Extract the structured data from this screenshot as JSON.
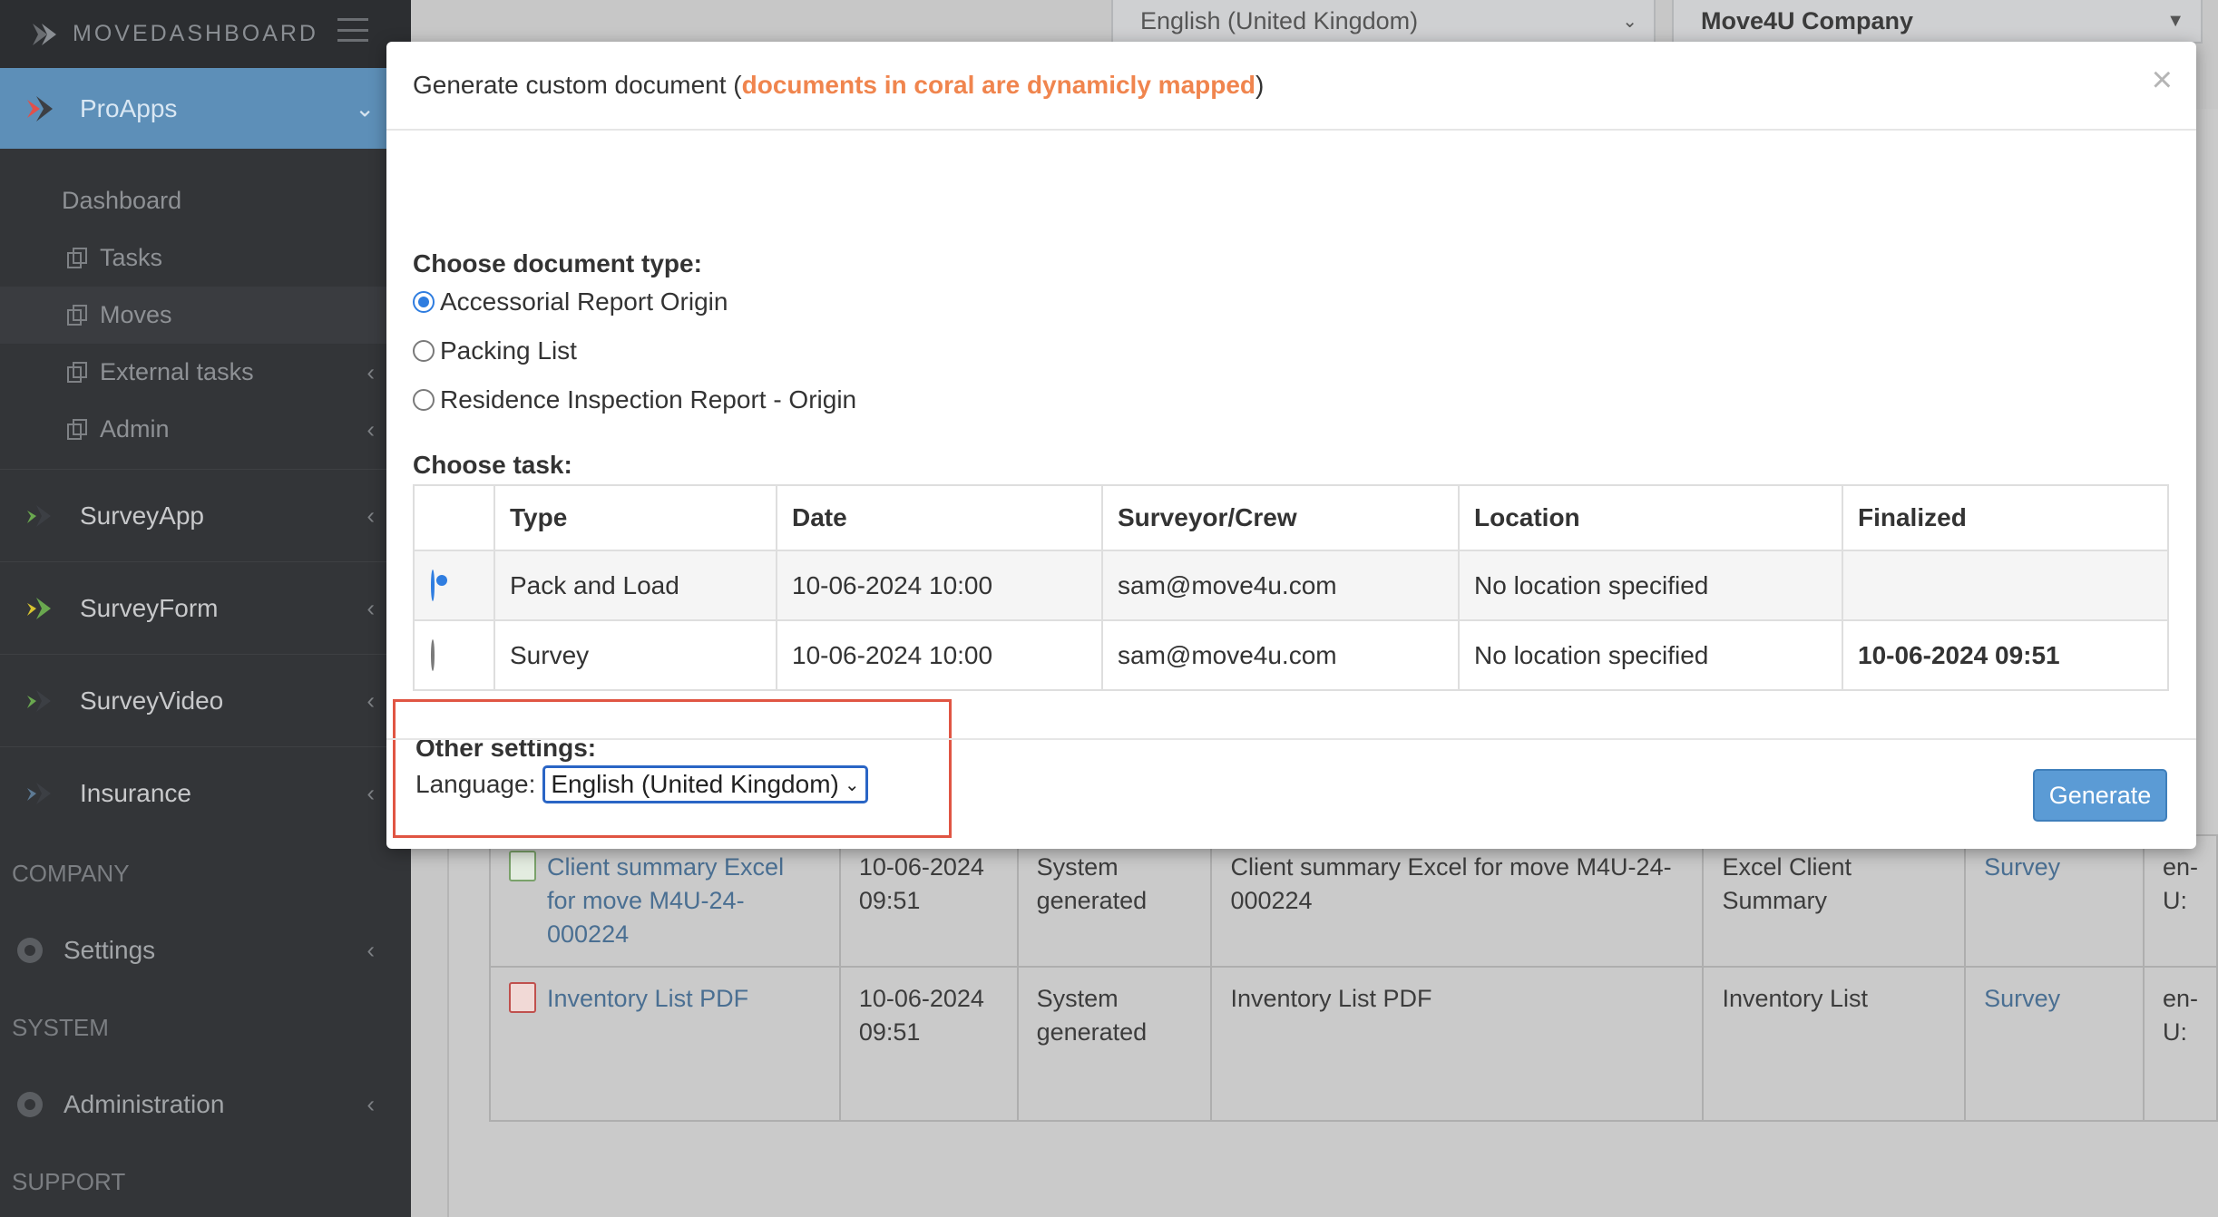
{
  "brand": {
    "logo_text": "MOVEDASHBOARD"
  },
  "sidebar": {
    "apps": [
      {
        "label": "ProApps"
      },
      {
        "label": "SurveyApp"
      },
      {
        "label": "SurveyForm"
      },
      {
        "label": "SurveyVideo"
      },
      {
        "label": "Insurance"
      }
    ],
    "submenu": [
      {
        "label": "Dashboard"
      },
      {
        "label": "Tasks"
      },
      {
        "label": "Moves"
      },
      {
        "label": "External tasks"
      },
      {
        "label": "Admin"
      }
    ],
    "sections": {
      "company": "COMPANY",
      "settings": "Settings",
      "system": "SYSTEM",
      "administration": "Administration",
      "support": "SUPPORT"
    }
  },
  "topbar": {
    "language": "English (United Kingdom)",
    "company": "Move4U Company"
  },
  "background_table": {
    "rows": [
      {
        "name": "Client summary Excel for move M4U-24-000224",
        "date": "10-06-2024 09:51",
        "source": "System generated",
        "description": "Client summary Excel for move M4U-24-000224",
        "type": "Excel Client Summary",
        "task": "Survey",
        "lang": "en-U:"
      },
      {
        "name": "Inventory List PDF",
        "date": "10-06-2024 09:51",
        "source": "System generated",
        "description": "Inventory List PDF",
        "type": "Inventory List",
        "task": "Survey",
        "lang": "en-U:"
      }
    ]
  },
  "modal": {
    "title_prefix": "Generate custom document (",
    "title_coral": "documents in coral are dynamicly mapped",
    "title_suffix": ")",
    "close": "×",
    "doc_type_label": "Choose document type:",
    "doc_types": [
      {
        "label": "Accessorial Report Origin",
        "checked": true
      },
      {
        "label": "Packing List",
        "checked": false
      },
      {
        "label": "Residence Inspection Report - Origin",
        "checked": false
      }
    ],
    "task_label": "Choose task:",
    "task_columns": [
      "Type",
      "Date",
      "Surveyor/Crew",
      "Location",
      "Finalized"
    ],
    "tasks": [
      {
        "type": "Pack and Load",
        "date": "10-06-2024 10:00",
        "crew": "sam@move4u.com",
        "location": "No location specified",
        "finalized": "",
        "selected": true
      },
      {
        "type": "Survey",
        "date": "10-06-2024 10:00",
        "crew": "sam@move4u.com",
        "location": "No location specified",
        "finalized": "10-06-2024 09:51",
        "selected": false
      }
    ],
    "other_settings_label": "Other settings:",
    "language_label": "Language:",
    "language_value": "English (United Kingdom)",
    "generate_label": "Generate"
  },
  "colors": {
    "sidebar_bg": "#333538",
    "active_app": "#5d8fb8",
    "coral": "#f0854e",
    "primary_button": "#5b9bd5",
    "highlight_box": "#e05543"
  },
  "icons": {
    "logo": "movedashboard-logo-icon",
    "hamburger": "hamburger-menu-icon",
    "app": "app-arrow-icon",
    "submenu": "copy-icon",
    "settings": "gear-icon",
    "administration": "admin-gear-icon",
    "excel": "excel-file-icon",
    "pdf": "pdf-file-icon"
  }
}
